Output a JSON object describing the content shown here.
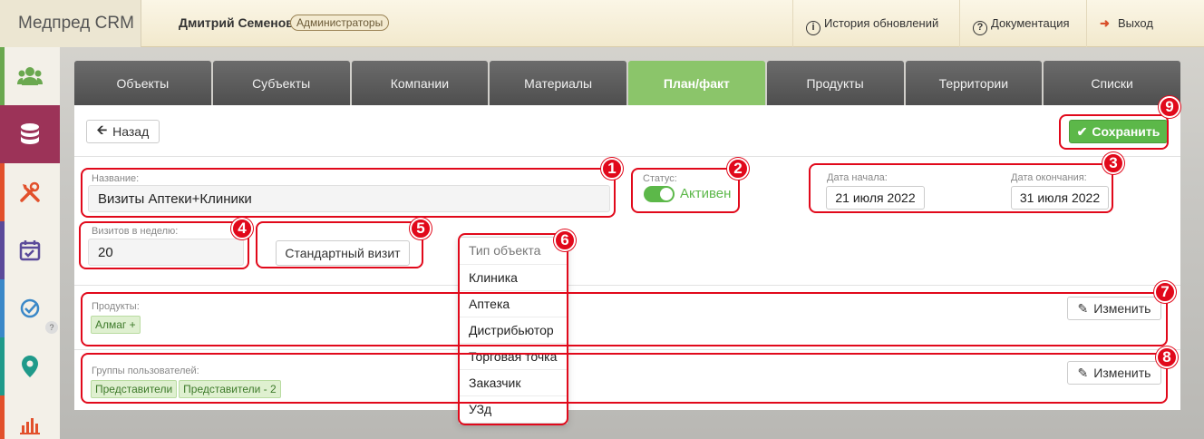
{
  "header": {
    "app_title": "Медпред CRM",
    "user_name": "Дмитрий Семенов",
    "user_role": "Администраторы",
    "nav": {
      "updates_label": "История обновлений",
      "docs_label": "Документация",
      "logout_label": "Выход"
    }
  },
  "sidebar": {
    "items": [
      {
        "icon": "users-icon",
        "color": "#6aa84f"
      },
      {
        "icon": "database-icon",
        "color": "#9c3358"
      },
      {
        "icon": "tools-icon",
        "color": "#e2502b"
      },
      {
        "icon": "calendar-check-icon",
        "color": "#5b4a9a"
      },
      {
        "icon": "check-circle-icon",
        "color": "#3a88c8"
      },
      {
        "icon": "map-marker-icon",
        "color": "#1f9a8a"
      },
      {
        "icon": "bar-chart-icon",
        "color": "#e2502b"
      }
    ]
  },
  "tabs": [
    {
      "label": "Объекты",
      "active": false
    },
    {
      "label": "Субъекты",
      "active": false
    },
    {
      "label": "Компании",
      "active": false
    },
    {
      "label": "Материалы",
      "active": false
    },
    {
      "label": "План/факт",
      "active": true
    },
    {
      "label": "Продукты",
      "active": false
    },
    {
      "label": "Территории",
      "active": false
    },
    {
      "label": "Списки",
      "active": false
    }
  ],
  "toolbar": {
    "back_label": "Назад",
    "save_label": "Сохранить"
  },
  "form": {
    "name_label": "Название:",
    "name_value": "Визиты Аптеки+Клиники",
    "status_label": "Статус:",
    "status_value": "Активен",
    "start_date_label": "Дата начала:",
    "start_date_value": "21 июля 2022",
    "end_date_label": "Дата окончания:",
    "end_date_value": "31 июля 2022",
    "visits_label": "Визитов в неделю:",
    "visits_value": "20",
    "visit_type_value": "Стандартный визит"
  },
  "object_type_dropdown": {
    "header": "Тип объекта",
    "options": [
      "Клиника",
      "Аптека",
      "Дистрибьютор",
      "Торговая точка",
      "Заказчик",
      "УЗд"
    ]
  },
  "products": {
    "label": "Продукты:",
    "tags": [
      "Алмаг +"
    ],
    "edit_label": "Изменить"
  },
  "user_groups": {
    "label": "Группы пользователей:",
    "tags": [
      "Представители",
      "Представители - 2"
    ],
    "edit_label": "Изменить"
  },
  "callouts": [
    "1",
    "2",
    "3",
    "4",
    "5",
    "6",
    "7",
    "8",
    "9"
  ],
  "colors": {
    "accent_green": "#5cb849",
    "active_tab": "#8bc56a",
    "callout_red": "#e1091b"
  }
}
